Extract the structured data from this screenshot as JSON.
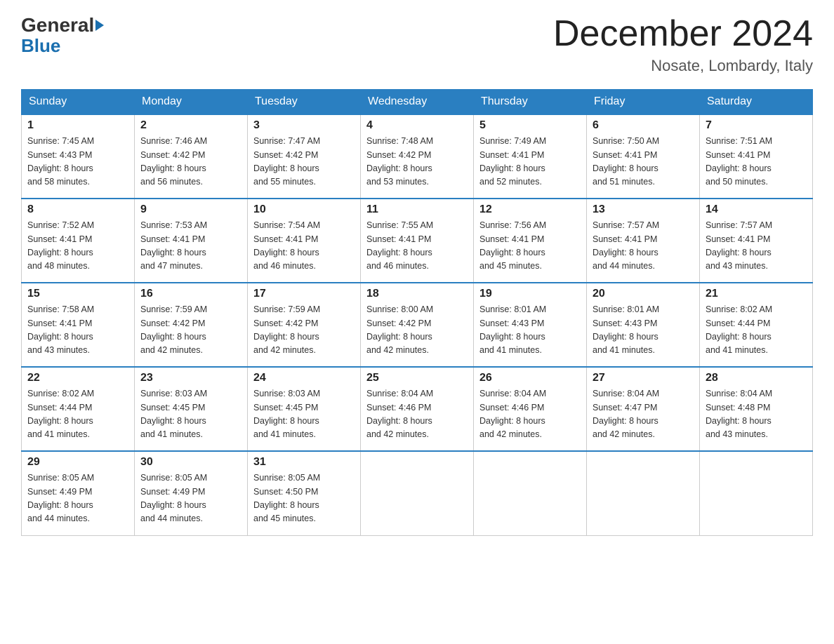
{
  "header": {
    "logo_general": "General",
    "logo_blue": "Blue",
    "month_year": "December 2024",
    "location": "Nosate, Lombardy, Italy"
  },
  "days_of_week": [
    "Sunday",
    "Monday",
    "Tuesday",
    "Wednesday",
    "Thursday",
    "Friday",
    "Saturday"
  ],
  "weeks": [
    [
      {
        "day": "1",
        "sunrise": "7:45 AM",
        "sunset": "4:43 PM",
        "daylight": "8 hours and 58 minutes."
      },
      {
        "day": "2",
        "sunrise": "7:46 AM",
        "sunset": "4:42 PM",
        "daylight": "8 hours and 56 minutes."
      },
      {
        "day": "3",
        "sunrise": "7:47 AM",
        "sunset": "4:42 PM",
        "daylight": "8 hours and 55 minutes."
      },
      {
        "day": "4",
        "sunrise": "7:48 AM",
        "sunset": "4:42 PM",
        "daylight": "8 hours and 53 minutes."
      },
      {
        "day": "5",
        "sunrise": "7:49 AM",
        "sunset": "4:41 PM",
        "daylight": "8 hours and 52 minutes."
      },
      {
        "day": "6",
        "sunrise": "7:50 AM",
        "sunset": "4:41 PM",
        "daylight": "8 hours and 51 minutes."
      },
      {
        "day": "7",
        "sunrise": "7:51 AM",
        "sunset": "4:41 PM",
        "daylight": "8 hours and 50 minutes."
      }
    ],
    [
      {
        "day": "8",
        "sunrise": "7:52 AM",
        "sunset": "4:41 PM",
        "daylight": "8 hours and 48 minutes."
      },
      {
        "day": "9",
        "sunrise": "7:53 AM",
        "sunset": "4:41 PM",
        "daylight": "8 hours and 47 minutes."
      },
      {
        "day": "10",
        "sunrise": "7:54 AM",
        "sunset": "4:41 PM",
        "daylight": "8 hours and 46 minutes."
      },
      {
        "day": "11",
        "sunrise": "7:55 AM",
        "sunset": "4:41 PM",
        "daylight": "8 hours and 46 minutes."
      },
      {
        "day": "12",
        "sunrise": "7:56 AM",
        "sunset": "4:41 PM",
        "daylight": "8 hours and 45 minutes."
      },
      {
        "day": "13",
        "sunrise": "7:57 AM",
        "sunset": "4:41 PM",
        "daylight": "8 hours and 44 minutes."
      },
      {
        "day": "14",
        "sunrise": "7:57 AM",
        "sunset": "4:41 PM",
        "daylight": "8 hours and 43 minutes."
      }
    ],
    [
      {
        "day": "15",
        "sunrise": "7:58 AM",
        "sunset": "4:41 PM",
        "daylight": "8 hours and 43 minutes."
      },
      {
        "day": "16",
        "sunrise": "7:59 AM",
        "sunset": "4:42 PM",
        "daylight": "8 hours and 42 minutes."
      },
      {
        "day": "17",
        "sunrise": "7:59 AM",
        "sunset": "4:42 PM",
        "daylight": "8 hours and 42 minutes."
      },
      {
        "day": "18",
        "sunrise": "8:00 AM",
        "sunset": "4:42 PM",
        "daylight": "8 hours and 42 minutes."
      },
      {
        "day": "19",
        "sunrise": "8:01 AM",
        "sunset": "4:43 PM",
        "daylight": "8 hours and 41 minutes."
      },
      {
        "day": "20",
        "sunrise": "8:01 AM",
        "sunset": "4:43 PM",
        "daylight": "8 hours and 41 minutes."
      },
      {
        "day": "21",
        "sunrise": "8:02 AM",
        "sunset": "4:44 PM",
        "daylight": "8 hours and 41 minutes."
      }
    ],
    [
      {
        "day": "22",
        "sunrise": "8:02 AM",
        "sunset": "4:44 PM",
        "daylight": "8 hours and 41 minutes."
      },
      {
        "day": "23",
        "sunrise": "8:03 AM",
        "sunset": "4:45 PM",
        "daylight": "8 hours and 41 minutes."
      },
      {
        "day": "24",
        "sunrise": "8:03 AM",
        "sunset": "4:45 PM",
        "daylight": "8 hours and 41 minutes."
      },
      {
        "day": "25",
        "sunrise": "8:04 AM",
        "sunset": "4:46 PM",
        "daylight": "8 hours and 42 minutes."
      },
      {
        "day": "26",
        "sunrise": "8:04 AM",
        "sunset": "4:46 PM",
        "daylight": "8 hours and 42 minutes."
      },
      {
        "day": "27",
        "sunrise": "8:04 AM",
        "sunset": "4:47 PM",
        "daylight": "8 hours and 42 minutes."
      },
      {
        "day": "28",
        "sunrise": "8:04 AM",
        "sunset": "4:48 PM",
        "daylight": "8 hours and 43 minutes."
      }
    ],
    [
      {
        "day": "29",
        "sunrise": "8:05 AM",
        "sunset": "4:49 PM",
        "daylight": "8 hours and 44 minutes."
      },
      {
        "day": "30",
        "sunrise": "8:05 AM",
        "sunset": "4:49 PM",
        "daylight": "8 hours and 44 minutes."
      },
      {
        "day": "31",
        "sunrise": "8:05 AM",
        "sunset": "4:50 PM",
        "daylight": "8 hours and 45 minutes."
      },
      null,
      null,
      null,
      null
    ]
  ],
  "labels": {
    "sunrise": "Sunrise:",
    "sunset": "Sunset:",
    "daylight": "Daylight:"
  },
  "colors": {
    "header_bg": "#2a7fc1",
    "header_text": "#ffffff",
    "border": "#2a7fc1"
  }
}
